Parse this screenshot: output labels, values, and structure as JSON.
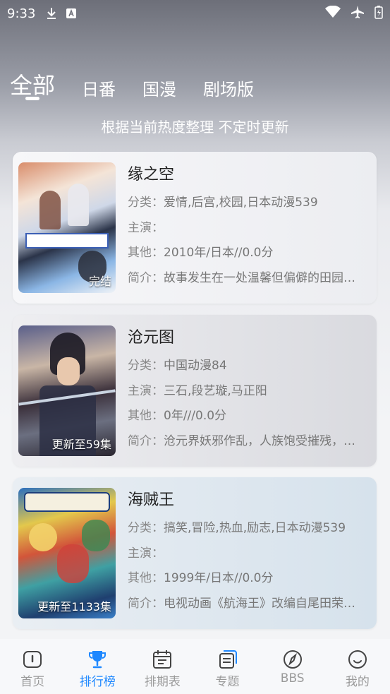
{
  "status": {
    "time": "9:33"
  },
  "tabs": [
    {
      "label": "全部",
      "active": true
    },
    {
      "label": "日番",
      "active": false
    },
    {
      "label": "国漫",
      "active": false
    },
    {
      "label": "剧场版",
      "active": false
    }
  ],
  "subtitle": "根据当前热度整理 不定时更新",
  "items": [
    {
      "title": "缘之空",
      "badge": "完结",
      "category_k": "分类：",
      "category": "爱情,后宫,校园,日本动漫539",
      "cast_k": "主演：",
      "cast": "",
      "other_k": "其他：",
      "other": "2010年/日本//0.0分",
      "intro_k": "简介：",
      "intro": "故事发生在一处温馨但偏僻的田园…"
    },
    {
      "title": "沧元图",
      "badge": "更新至59集",
      "category_k": "分类：",
      "category": "中国动漫84",
      "cast_k": "主演：",
      "cast": "三石,段艺璇,马正阳",
      "other_k": "其他：",
      "other": "0年///0.0分",
      "intro_k": "简介：",
      "intro": "沧元界妖邪作乱，人族饱受摧残，…"
    },
    {
      "title": "海贼王",
      "badge": "更新至1133集",
      "category_k": "分类：",
      "category": "搞笑,冒险,热血,励志,日本动漫539",
      "cast_k": "主演：",
      "cast": "",
      "other_k": "其他：",
      "other": "1999年/日本//0.0分",
      "intro_k": "简介：",
      "intro": "电视动画《航海王》改编自尾田荣…"
    }
  ],
  "nav": [
    {
      "label": "首页",
      "icon": "home-icon",
      "active": false
    },
    {
      "label": "排行榜",
      "icon": "trophy-icon",
      "active": true
    },
    {
      "label": "排期表",
      "icon": "calendar-icon",
      "active": false
    },
    {
      "label": "专题",
      "icon": "topic-icon",
      "active": false
    },
    {
      "label": "BBS",
      "icon": "compass-icon",
      "active": false
    },
    {
      "label": "我的",
      "icon": "profile-icon",
      "active": false
    }
  ],
  "colors": {
    "accent": "#1e88ff",
    "inactive": "#9a9a9a"
  }
}
